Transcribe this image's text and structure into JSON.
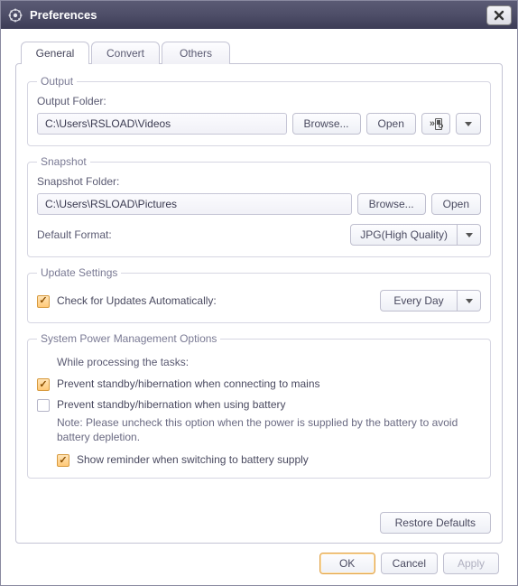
{
  "window": {
    "title": "Preferences"
  },
  "tabs": {
    "general": "General",
    "convert": "Convert",
    "others": "Others"
  },
  "output": {
    "legend": "Output",
    "folder_label": "Output Folder:",
    "folder_value": "C:\\Users\\RSLOAD\\Videos",
    "browse": "Browse...",
    "open": "Open"
  },
  "snapshot": {
    "legend": "Snapshot",
    "folder_label": "Snapshot Folder:",
    "folder_value": "C:\\Users\\RSLOAD\\Pictures",
    "browse": "Browse...",
    "open": "Open",
    "format_label": "Default Format:",
    "format_value": "JPG(High Quality)"
  },
  "update": {
    "legend": "Update Settings",
    "check_label": "Check for Updates Automatically:",
    "frequency": "Every Day"
  },
  "power": {
    "legend": "System Power Management Options",
    "while_label": "While processing the tasks:",
    "opt_mains": "Prevent standby/hibernation when connecting to mains",
    "opt_battery": "Prevent standby/hibernation when using battery",
    "note": "Note: Please uncheck this option when the power is supplied by the battery to avoid battery depletion.",
    "opt_reminder": "Show reminder when switching to battery supply"
  },
  "buttons": {
    "restore": "Restore Defaults",
    "ok": "OK",
    "cancel": "Cancel",
    "apply": "Apply"
  }
}
